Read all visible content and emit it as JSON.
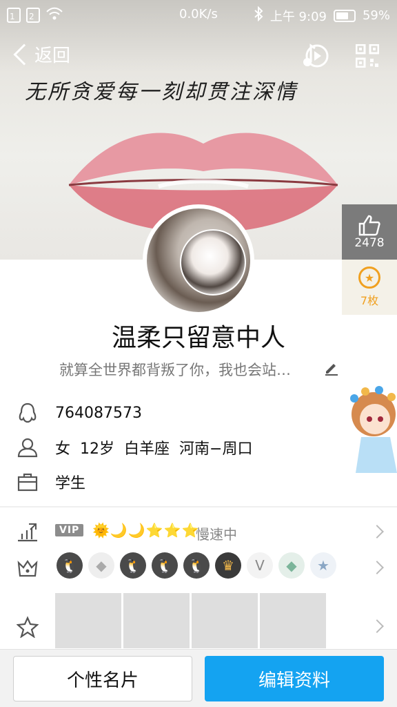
{
  "status_bar": {
    "sim1": "1",
    "sim2": "2",
    "net_speed": "0.0K/s",
    "time": "上午 9:09",
    "battery": "59%",
    "battery_level": 0.59
  },
  "nav": {
    "back_label": "返回",
    "music_icon": "music-icon",
    "qr_icon": "qr-code-icon"
  },
  "cover": {
    "quote": "无所贪爱每一刻却贯注深情"
  },
  "likes": {
    "count": "2478",
    "icon": "thumbs-up-icon"
  },
  "badges_count": {
    "label": "7枚",
    "icon": "star-badge-icon"
  },
  "profile": {
    "name": "温柔只留意中人",
    "signature": "就算全世界都背叛了你，我也会站…"
  },
  "info": {
    "qq_number": "764087573",
    "gender": "女",
    "age": "12岁",
    "zodiac": "白羊座",
    "location": "河南−周口",
    "occupation": "学生"
  },
  "level": {
    "vip_label": "VIP",
    "level_icons": "🌞🌙🌙⭐⭐⭐",
    "speed_status": "慢速中"
  },
  "badge_icons": [
    "penguin",
    "diamond",
    "penguin-star",
    "penguin-lightning",
    "penguin-bow",
    "penguin-crown",
    "cloud-v",
    "diamond-green",
    "star-blue"
  ],
  "colors": {
    "accent": "#14a3f1",
    "like_bg": "#7b7b7b",
    "badge_gold": "#f0a020"
  },
  "actions": {
    "card_label": "个性名片",
    "edit_label": "编辑资料"
  }
}
